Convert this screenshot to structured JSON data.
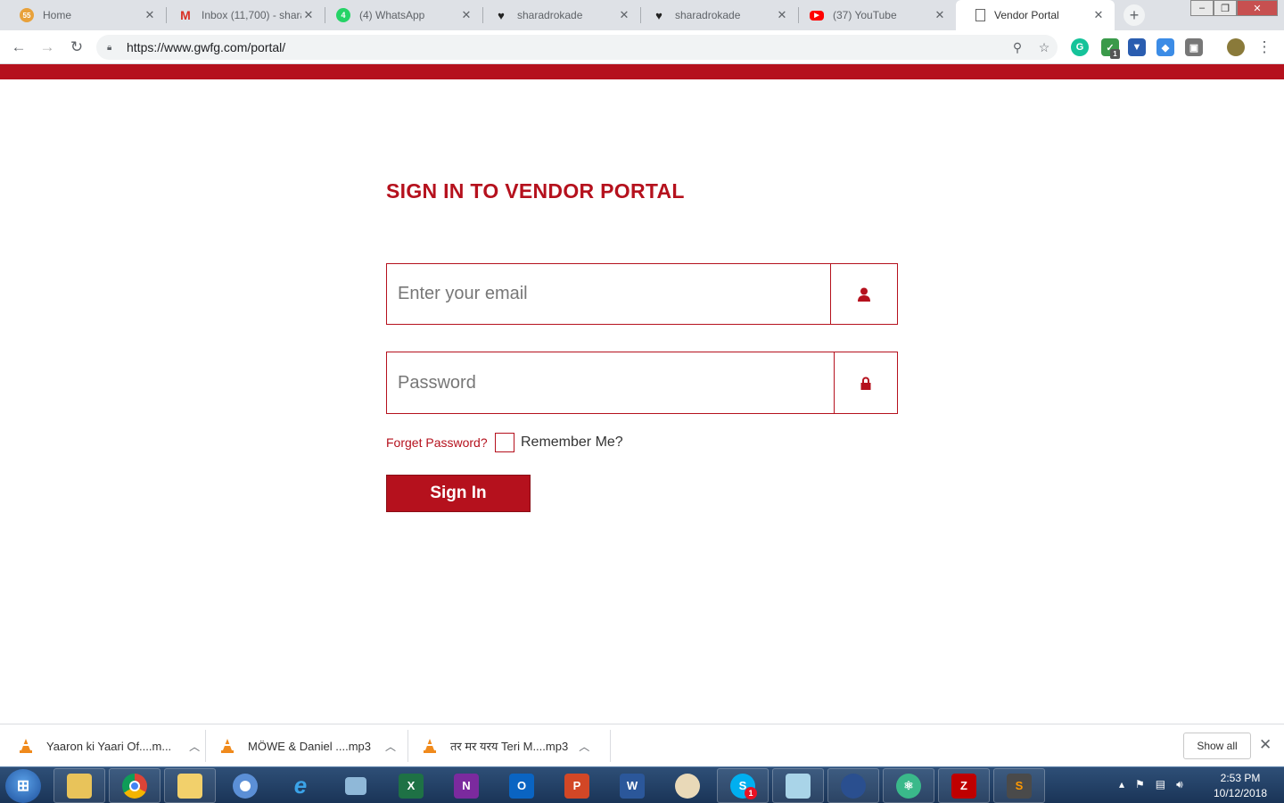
{
  "browser": {
    "tabs": [
      {
        "title": "Home",
        "active": false
      },
      {
        "title": "Inbox (11,700) - shara",
        "active": false
      },
      {
        "title": "(4) WhatsApp",
        "active": false
      },
      {
        "title": "sharadrokade",
        "active": false
      },
      {
        "title": "sharadrokade",
        "active": false
      },
      {
        "title": "(37) YouTube",
        "active": false
      },
      {
        "title": "Vendor Portal",
        "active": true
      }
    ],
    "url": "https://www.gwfg.com/portal/",
    "new_tab_label": "+",
    "extension_badge": "1"
  },
  "page": {
    "heading": "SIGN IN TO VENDOR PORTAL",
    "email": {
      "placeholder": "Enter your email",
      "value": ""
    },
    "password": {
      "placeholder": "Password",
      "value": ""
    },
    "forget_password": "Forget Password?",
    "remember_me": "Remember Me?",
    "remember_checked": false,
    "sign_in": "Sign In",
    "accent_color": "#b5111d"
  },
  "downloads": {
    "items": [
      {
        "name": "Yaaron ki Yaari Of....m..."
      },
      {
        "name": "MÖWE & Daniel ....mp3"
      },
      {
        "name": "तर मर यरय Teri M....mp3"
      }
    ],
    "show_all": "Show all"
  },
  "taskbar": {
    "time": "2:53 PM",
    "date": "10/12/2018",
    "skype_badge": "1"
  }
}
